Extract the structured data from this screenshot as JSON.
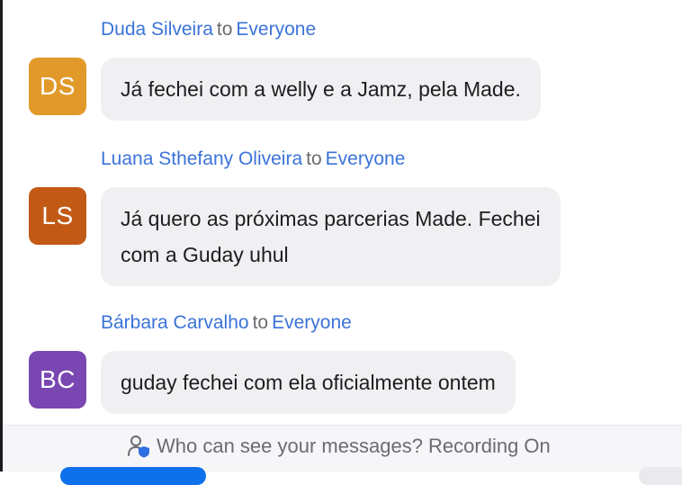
{
  "messages": [
    {
      "sender": "Duda Silveira",
      "to_word": "to",
      "recipient": "Everyone",
      "initials": "DS",
      "avatar_color": "#e19a2a",
      "lines": [
        "Já fechei com a welly e a Jamz, pela Made."
      ]
    },
    {
      "sender": "Luana Sthefany Oliveira",
      "to_word": "to",
      "recipient": "Everyone",
      "initials": "LS",
      "avatar_color": "#c25a16",
      "lines": [
        "Já quero as próximas parcerias Made. Fechei",
        "com a Guday uhul"
      ]
    },
    {
      "sender": "Bárbara Carvalho",
      "to_word": "to",
      "recipient": "Everyone",
      "initials": "BC",
      "avatar_color": "#7a46b2",
      "lines": [
        "guday fechei com ela oficialmente ontem"
      ]
    }
  ],
  "footer": {
    "privacy_text": "Who can see your messages? Recording On",
    "icon": "person-shield-icon"
  },
  "colors": {
    "link_blue": "#3b73d9",
    "bubble_bg": "#f0f0f3",
    "footer_bg": "#f6f6f8",
    "primary_button": "#0e71eb"
  }
}
